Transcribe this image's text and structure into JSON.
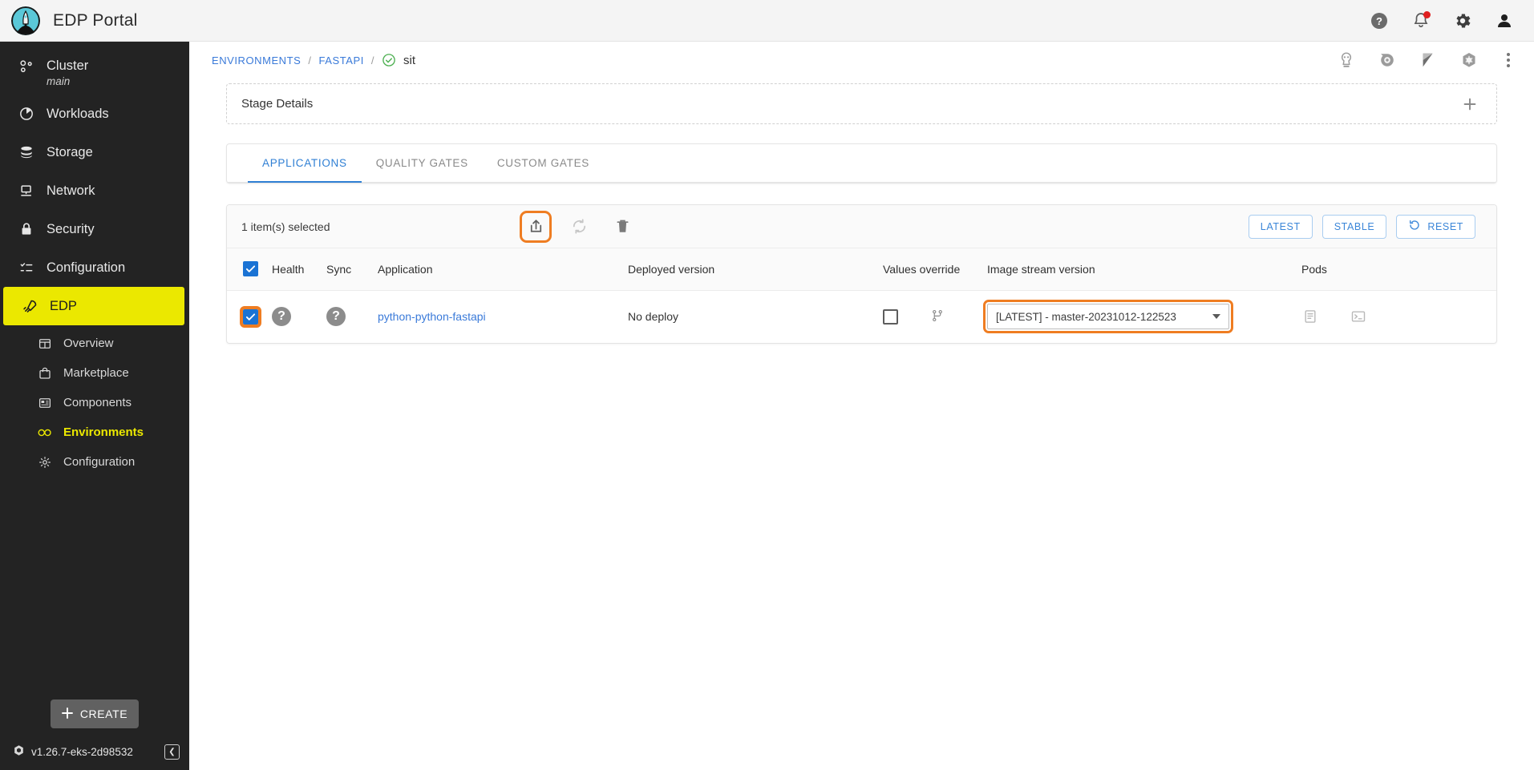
{
  "header": {
    "app_title": "EDP Portal",
    "logo_icon": "rocket-logo-icon",
    "icons": [
      {
        "name": "help-icon",
        "label": "Help"
      },
      {
        "name": "notifications-icon",
        "label": "Notifications"
      },
      {
        "name": "settings-icon",
        "label": "Settings"
      },
      {
        "name": "account-icon",
        "label": "Account"
      }
    ],
    "has_notification_dot": true
  },
  "sidebar": {
    "items": [
      {
        "label": "Cluster",
        "sub": "main",
        "icon": "cluster-icon"
      },
      {
        "label": "Workloads",
        "icon": "workloads-icon"
      },
      {
        "label": "Storage",
        "icon": "storage-icon"
      },
      {
        "label": "Network",
        "icon": "network-icon"
      },
      {
        "label": "Security",
        "icon": "security-icon"
      },
      {
        "label": "Configuration",
        "icon": "configuration-icon"
      },
      {
        "label": "EDP",
        "icon": "edp-rocket-icon",
        "active": true
      }
    ],
    "sub_items": [
      {
        "label": "Overview",
        "icon": "overview-icon"
      },
      {
        "label": "Marketplace",
        "icon": "marketplace-icon"
      },
      {
        "label": "Components",
        "icon": "components-icon"
      },
      {
        "label": "Environments",
        "icon": "environments-icon",
        "active": true
      },
      {
        "label": "Configuration",
        "icon": "gear-icon"
      }
    ],
    "create_label": "CREATE",
    "version": "v1.26.7-eks-2d98532",
    "collapse_label": "❮",
    "active_color": "#ebe800"
  },
  "breadcrumb": {
    "items": [
      {
        "label": "ENVIRONMENTS",
        "link": true
      },
      {
        "label": "FASTAPI",
        "link": true
      }
    ],
    "separator": "/",
    "current": "sit",
    "status_icon": "check-circle-icon",
    "status_color": "#4caf50"
  },
  "page_tools": [
    {
      "name": "argocd-icon"
    },
    {
      "name": "grafana-icon"
    },
    {
      "name": "kibana-icon"
    },
    {
      "name": "kubernetes-icon"
    },
    {
      "name": "more-options-icon"
    }
  ],
  "stage_panel": {
    "title": "Stage Details",
    "expand_icon": "plus-icon"
  },
  "tabs": [
    {
      "label": "APPLICATIONS",
      "active": true
    },
    {
      "label": "QUALITY GATES",
      "active": false
    },
    {
      "label": "CUSTOM GATES",
      "active": false
    }
  ],
  "toolbar": {
    "selection_text": "1 item(s) selected",
    "actions": [
      {
        "name": "deploy-icon",
        "highlighted": true,
        "enabled": true
      },
      {
        "name": "refresh-icon",
        "highlighted": false,
        "enabled": false
      },
      {
        "name": "delete-icon",
        "highlighted": false,
        "enabled": true
      }
    ],
    "buttons": [
      {
        "label": "LATEST",
        "icon": null
      },
      {
        "label": "STABLE",
        "icon": null
      },
      {
        "label": "RESET",
        "icon": "rotate-ccw-icon"
      }
    ],
    "highlight_color": "#ef7d22"
  },
  "table": {
    "columns": [
      {
        "key": "select",
        "label": ""
      },
      {
        "key": "health",
        "label": "Health"
      },
      {
        "key": "sync",
        "label": "Sync"
      },
      {
        "key": "application",
        "label": "Application"
      },
      {
        "key": "deployed_version",
        "label": "Deployed version"
      },
      {
        "key": "values_override",
        "label": "Values override"
      },
      {
        "key": "image_stream_version",
        "label": "Image stream version"
      },
      {
        "key": "pods",
        "label": "Pods"
      }
    ],
    "header_checkbox_checked": true,
    "rows": [
      {
        "selected": true,
        "selection_highlighted": true,
        "health": "?",
        "sync": "?",
        "application": "python-python-fastapi",
        "deployed_version": "No deploy",
        "values_override_checked": false,
        "values_override_icon": "git-branch-icon",
        "image_stream_version": "[LATEST] - master-20231012-122523",
        "image_stream_highlighted": true,
        "pods_icons": [
          "logs-icon",
          "terminal-icon"
        ]
      }
    ]
  }
}
